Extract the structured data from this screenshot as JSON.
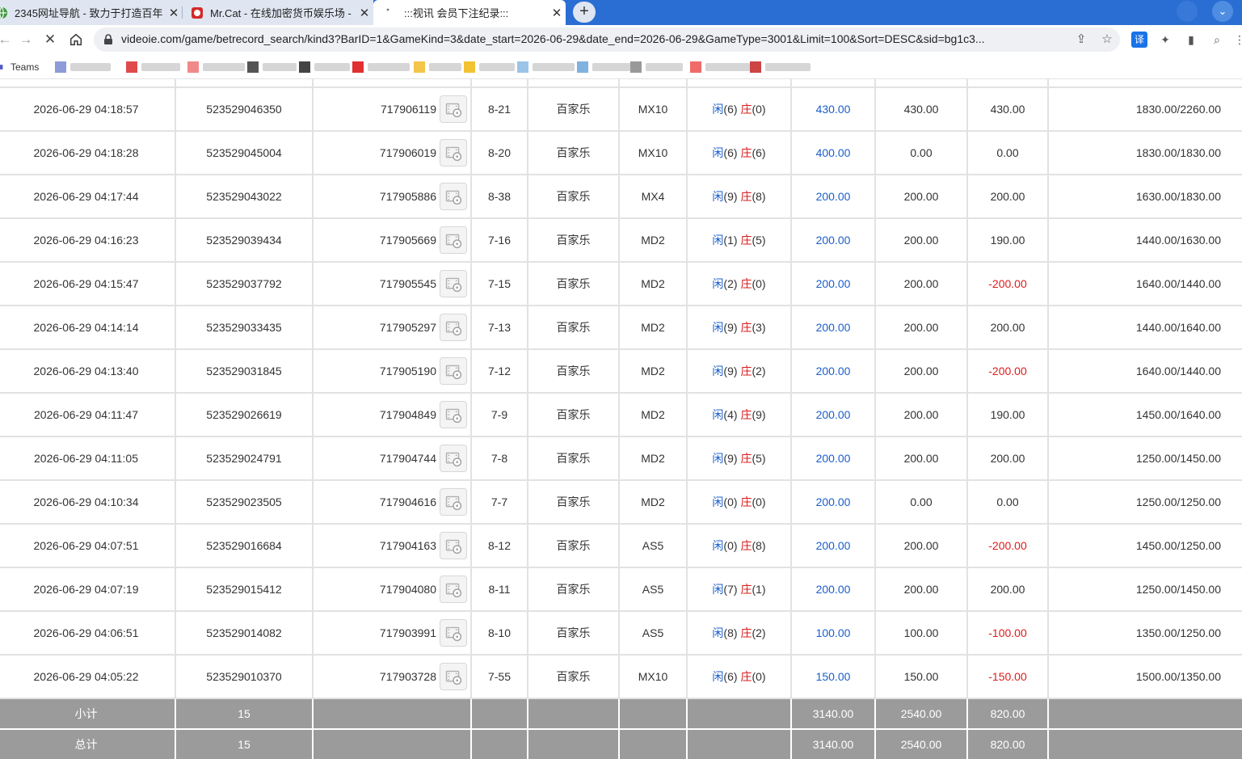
{
  "browser": {
    "tabs": [
      {
        "title": "2345网址导航 - 致力于打造百年",
        "active": false
      },
      {
        "title": "Mr.Cat - 在线加密货币娱乐场 - ",
        "active": false
      },
      {
        "title": ":::视讯 会员下注纪录:::",
        "active": true
      }
    ],
    "new_tab": "+",
    "close_glyph": "✕",
    "url": "videoie.com/game/betrecord_search/kind3?BarID=1&GameKind=3&date_start=2026-06-29&date_end=2026-06-29&GameType=3001&Limit=100&Sort=DESC&sid=bg1c3...",
    "bookmark_label": "Teams",
    "translate_label": "译",
    "colors": {
      "tabstrip": "#2a6ed3",
      "link_blue": "#1b5fcc",
      "loss_red": "#e01b1b",
      "summary_bg": "#9b9b9b"
    }
  },
  "rows": [
    {
      "time": "2026-06-29 04:18:57",
      "bet_id": "523529046350",
      "round_id": "717906119",
      "shoe": "8-21",
      "game": "百家乐",
      "table": "MX10",
      "player_label": "闲",
      "player": "(6)",
      "banker_label": "庄",
      "banker": "(0)",
      "bet": "430.00",
      "valid": "430.00",
      "win": "430.00",
      "win_neg": false,
      "balance": "1830.00/2260.00"
    },
    {
      "time": "2026-06-29 04:18:28",
      "bet_id": "523529045004",
      "round_id": "717906019",
      "shoe": "8-20",
      "game": "百家乐",
      "table": "MX10",
      "player_label": "闲",
      "player": "(6)",
      "banker_label": "庄",
      "banker": "(6)",
      "bet": "400.00",
      "valid": "0.00",
      "win": "0.00",
      "win_neg": false,
      "balance": "1830.00/1830.00"
    },
    {
      "time": "2026-06-29 04:17:44",
      "bet_id": "523529043022",
      "round_id": "717905886",
      "shoe": "8-38",
      "game": "百家乐",
      "table": "MX4",
      "player_label": "闲",
      "player": "(9)",
      "banker_label": "庄",
      "banker": "(8)",
      "bet": "200.00",
      "valid": "200.00",
      "win": "200.00",
      "win_neg": false,
      "balance": "1630.00/1830.00"
    },
    {
      "time": "2026-06-29 04:16:23",
      "bet_id": "523529039434",
      "round_id": "717905669",
      "shoe": "7-16",
      "game": "百家乐",
      "table": "MD2",
      "player_label": "闲",
      "player": "(1)",
      "banker_label": "庄",
      "banker": "(5)",
      "bet": "200.00",
      "valid": "200.00",
      "win": "190.00",
      "win_neg": false,
      "balance": "1440.00/1630.00"
    },
    {
      "time": "2026-06-29 04:15:47",
      "bet_id": "523529037792",
      "round_id": "717905545",
      "shoe": "7-15",
      "game": "百家乐",
      "table": "MD2",
      "player_label": "闲",
      "player": "(2)",
      "banker_label": "庄",
      "banker": "(0)",
      "bet": "200.00",
      "valid": "200.00",
      "win": "-200.00",
      "win_neg": true,
      "balance": "1640.00/1440.00"
    },
    {
      "time": "2026-06-29 04:14:14",
      "bet_id": "523529033435",
      "round_id": "717905297",
      "shoe": "7-13",
      "game": "百家乐",
      "table": "MD2",
      "player_label": "闲",
      "player": "(9)",
      "banker_label": "庄",
      "banker": "(3)",
      "bet": "200.00",
      "valid": "200.00",
      "win": "200.00",
      "win_neg": false,
      "balance": "1440.00/1640.00"
    },
    {
      "time": "2026-06-29 04:13:40",
      "bet_id": "523529031845",
      "round_id": "717905190",
      "shoe": "7-12",
      "game": "百家乐",
      "table": "MD2",
      "player_label": "闲",
      "player": "(9)",
      "banker_label": "庄",
      "banker": "(2)",
      "bet": "200.00",
      "valid": "200.00",
      "win": "-200.00",
      "win_neg": true,
      "balance": "1640.00/1440.00"
    },
    {
      "time": "2026-06-29 04:11:47",
      "bet_id": "523529026619",
      "round_id": "717904849",
      "shoe": "7-9",
      "game": "百家乐",
      "table": "MD2",
      "player_label": "闲",
      "player": "(4)",
      "banker_label": "庄",
      "banker": "(9)",
      "bet": "200.00",
      "valid": "200.00",
      "win": "190.00",
      "win_neg": false,
      "balance": "1450.00/1640.00"
    },
    {
      "time": "2026-06-29 04:11:05",
      "bet_id": "523529024791",
      "round_id": "717904744",
      "shoe": "7-8",
      "game": "百家乐",
      "table": "MD2",
      "player_label": "闲",
      "player": "(9)",
      "banker_label": "庄",
      "banker": "(5)",
      "bet": "200.00",
      "valid": "200.00",
      "win": "200.00",
      "win_neg": false,
      "balance": "1250.00/1450.00"
    },
    {
      "time": "2026-06-29 04:10:34",
      "bet_id": "523529023505",
      "round_id": "717904616",
      "shoe": "7-7",
      "game": "百家乐",
      "table": "MD2",
      "player_label": "闲",
      "player": "(0)",
      "banker_label": "庄",
      "banker": "(0)",
      "bet": "200.00",
      "valid": "0.00",
      "win": "0.00",
      "win_neg": false,
      "balance": "1250.00/1250.00"
    },
    {
      "time": "2026-06-29 04:07:51",
      "bet_id": "523529016684",
      "round_id": "717904163",
      "shoe": "8-12",
      "game": "百家乐",
      "table": "AS5",
      "player_label": "闲",
      "player": "(0)",
      "banker_label": "庄",
      "banker": "(8)",
      "bet": "200.00",
      "valid": "200.00",
      "win": "-200.00",
      "win_neg": true,
      "balance": "1450.00/1250.00"
    },
    {
      "time": "2026-06-29 04:07:19",
      "bet_id": "523529015412",
      "round_id": "717904080",
      "shoe": "8-11",
      "game": "百家乐",
      "table": "AS5",
      "player_label": "闲",
      "player": "(7)",
      "banker_label": "庄",
      "banker": "(1)",
      "bet": "200.00",
      "valid": "200.00",
      "win": "200.00",
      "win_neg": false,
      "balance": "1250.00/1450.00"
    },
    {
      "time": "2026-06-29 04:06:51",
      "bet_id": "523529014082",
      "round_id": "717903991",
      "shoe": "8-10",
      "game": "百家乐",
      "table": "AS5",
      "player_label": "闲",
      "player": "(8)",
      "banker_label": "庄",
      "banker": "(2)",
      "bet": "100.00",
      "valid": "100.00",
      "win": "-100.00",
      "win_neg": true,
      "balance": "1350.00/1250.00"
    },
    {
      "time": "2026-06-29 04:05:22",
      "bet_id": "523529010370",
      "round_id": "717903728",
      "shoe": "7-55",
      "game": "百家乐",
      "table": "MX10",
      "player_label": "闲",
      "player": "(6)",
      "banker_label": "庄",
      "banker": "(0)",
      "bet": "150.00",
      "valid": "150.00",
      "win": "-150.00",
      "win_neg": true,
      "balance": "1500.00/1350.00"
    }
  ],
  "subtotal": {
    "label": "小计",
    "count": "15",
    "bet": "3140.00",
    "valid": "2540.00",
    "win": "820.00"
  },
  "total": {
    "label": "总计",
    "count": "15",
    "bet": "3140.00",
    "valid": "2540.00",
    "win": "820.00"
  }
}
